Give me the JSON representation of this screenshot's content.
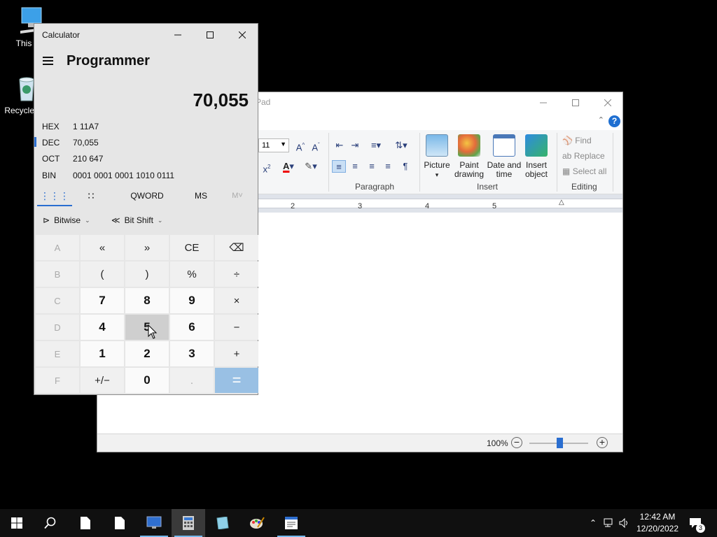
{
  "desktop": {
    "icons": [
      {
        "label": "This PC"
      },
      {
        "label": "Recycle Bin"
      }
    ]
  },
  "wordpad": {
    "title": "Document - WordPad",
    "title_visible": "Pad",
    "font_size": "11",
    "paragraph_label": "Paragraph",
    "insert_label": "Insert",
    "editing_label": "Editing",
    "picture_label": "Picture",
    "paint_label": "Paint drawing",
    "datetime_label": "Date and time",
    "insert_object_label": "Insert object",
    "find_label": "Find",
    "replace_label": "Replace",
    "select_all_label": "Select all",
    "ruler_marks": [
      "2",
      "3",
      "4",
      "5"
    ],
    "zoom_level": "100%",
    "help_glyph": "?"
  },
  "calculator": {
    "app_title": "Calculator",
    "mode": "Programmer",
    "display": "70,055",
    "radix": [
      {
        "name": "HEX",
        "value": "1 11A7"
      },
      {
        "name": "DEC",
        "value": "70,055"
      },
      {
        "name": "OCT",
        "value": "210 647"
      },
      {
        "name": "BIN",
        "value": "0001 0001 0001 1010 0111"
      }
    ],
    "tabs": {
      "word_size": "QWORD",
      "ms": "MS",
      "mplus": "M˅"
    },
    "bitwise_label": "Bitwise",
    "bitshift_label": "Bit Shift",
    "keys": [
      [
        "A",
        "«",
        "»",
        "CE",
        "⌫"
      ],
      [
        "B",
        "(",
        ")",
        "%",
        "÷"
      ],
      [
        "C",
        "7",
        "8",
        "9",
        "×"
      ],
      [
        "D",
        "4",
        "5",
        "6",
        "−"
      ],
      [
        "E",
        "1",
        "2",
        "3",
        "+"
      ],
      [
        "F",
        "+/−",
        "0",
        ".",
        "="
      ]
    ]
  },
  "taskbar": {
    "time": "12:42 AM",
    "date": "12/20/2022",
    "notification_count": "3"
  },
  "colors": {
    "accent": "#2a6ed0",
    "equals": "#99c0e4",
    "taskbar": "#101010"
  }
}
